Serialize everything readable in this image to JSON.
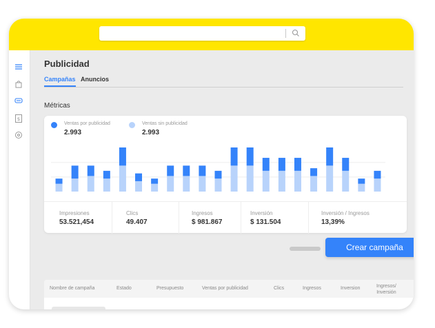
{
  "page": {
    "title": "Publicidad"
  },
  "tabs": [
    {
      "label": "Campañas",
      "active": true
    },
    {
      "label": "Anuncios",
      "active": false
    }
  ],
  "section_title": "Métricas",
  "legend": [
    {
      "label": "Ventas por publicidad",
      "value": "2.993",
      "color": "#3483fa"
    },
    {
      "label": "Ventas sin publicidad",
      "value": "2.993",
      "color": "#b8d3fb"
    }
  ],
  "chart_data": {
    "type": "bar",
    "stacked": true,
    "categories": [],
    "series": [
      {
        "name": "Ventas sin publicidad",
        "color": "#b8d3fb",
        "values": [
          3,
          5,
          6,
          5,
          10,
          4,
          3,
          6,
          6,
          6,
          5,
          10,
          10,
          8,
          8,
          8,
          6,
          10,
          8,
          3,
          5
        ]
      },
      {
        "name": "Ventas por publicidad",
        "color": "#3483fa",
        "values": [
          2,
          5,
          4,
          3,
          7,
          3,
          2,
          4,
          4,
          4,
          3,
          7,
          7,
          5,
          5,
          5,
          3,
          7,
          5,
          2,
          3
        ]
      }
    ],
    "ylim": [
      0,
      17
    ],
    "grid": true,
    "legend_position": "top-left"
  },
  "metrics": [
    {
      "label": "Impresiones",
      "value": "53.521,454"
    },
    {
      "label": "Clics",
      "value": "49.407"
    },
    {
      "label": "Ingresos",
      "value": "$ 981.867"
    },
    {
      "label": "Inversión",
      "value": "$ 131.504"
    },
    {
      "label": "Inversión / Ingresos",
      "value": "13,39%"
    }
  ],
  "create_button": {
    "label": "Crear campaña"
  },
  "table": {
    "headers": [
      "Nombre de campaña",
      "Estado",
      "Presupuesto",
      "Ventas por publicidad",
      "Clics",
      "Ingresos",
      "Inversion",
      "Ingresos/\nInversión"
    ],
    "rows": [
      {
        "estado_on": true
      }
    ]
  },
  "sidebar": {
    "icons": [
      "menu-icon",
      "bag-icon",
      "megaphone-icon",
      "invoice-icon",
      "settings-icon"
    ]
  },
  "colors": {
    "accent": "#3483fa",
    "brand_yellow": "#ffe600",
    "light_bar": "#b8d3fb"
  }
}
